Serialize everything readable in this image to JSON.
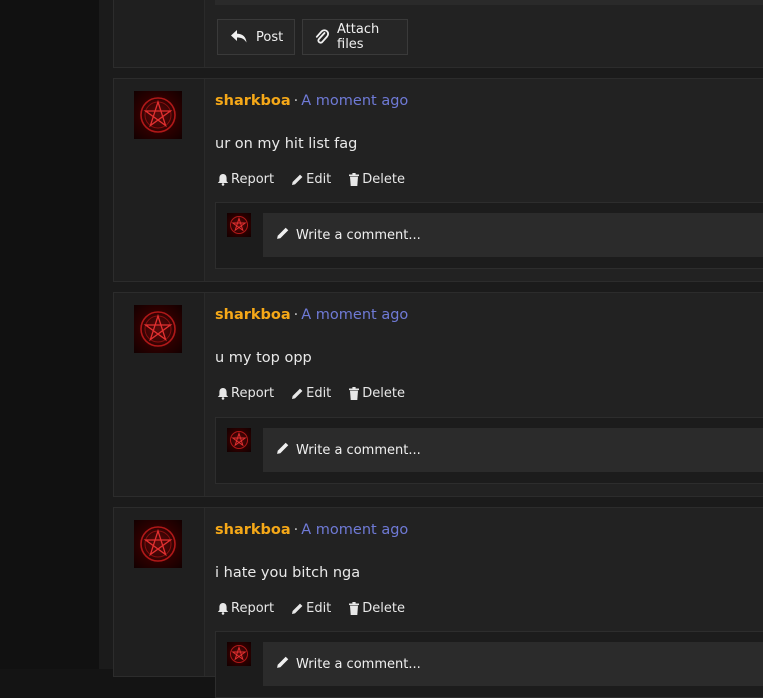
{
  "editor": {
    "post_label": "Post",
    "attach_label": "Attach files"
  },
  "comments": [
    {
      "username": "sharkboa",
      "separator": "·",
      "time": "A moment ago",
      "text": "ur on my hit list fag"
    },
    {
      "username": "sharkboa",
      "separator": "·",
      "time": "A moment ago",
      "text": "u my top opp"
    },
    {
      "username": "sharkboa",
      "separator": "·",
      "time": "A moment ago",
      "text": "i hate you bitch nga"
    }
  ],
  "actions": {
    "report": "Report",
    "edit": "Edit",
    "delete": "Delete"
  },
  "reply": {
    "placeholder": "Write a comment..."
  },
  "colors": {
    "username": "#f5a818",
    "time": "#6f7ad6",
    "panel": "#222222",
    "background": "#141414"
  }
}
